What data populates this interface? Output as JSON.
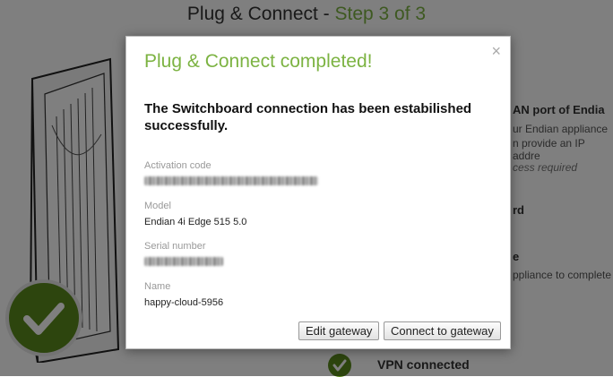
{
  "page": {
    "title_prefix": "Plug & Connect - ",
    "title_step": "Step 3 of 3",
    "background_items": [
      {
        "text": "AN port of Endia",
        "kind": "bold"
      },
      {
        "text": "ur Endian appliance",
        "kind": "small"
      },
      {
        "text": "n provide an IP addre",
        "kind": "small"
      },
      {
        "text": "cess required",
        "kind": "italic"
      },
      {
        "text": "rd",
        "kind": "bold"
      },
      {
        "text": "e",
        "kind": "bold"
      },
      {
        "text": "ppliance to complete",
        "kind": "small"
      }
    ],
    "vpn_label": "VPN connected"
  },
  "modal": {
    "close_symbol": "×",
    "title": "Plug & Connect completed!",
    "message": "The Switchboard connection has been estabilished successfully.",
    "fields": {
      "activation": {
        "label": "Activation code",
        "obscured": true
      },
      "model": {
        "label": "Model",
        "value": "Endian 4i Edge 515 5.0"
      },
      "serial": {
        "label": "Serial number",
        "obscured": true
      },
      "name": {
        "label": "Name",
        "value": "happy-cloud-5956"
      }
    },
    "buttons": {
      "edit": "Edit gateway",
      "connect": "Connect to gateway"
    }
  },
  "colors": {
    "accent_green": "#7cb342",
    "check_green": "#5a8a1c",
    "overlay": "rgba(0,0,0,0.5)"
  },
  "icons": [
    "router-illustration",
    "checkmark-icon",
    "close-icon"
  ]
}
